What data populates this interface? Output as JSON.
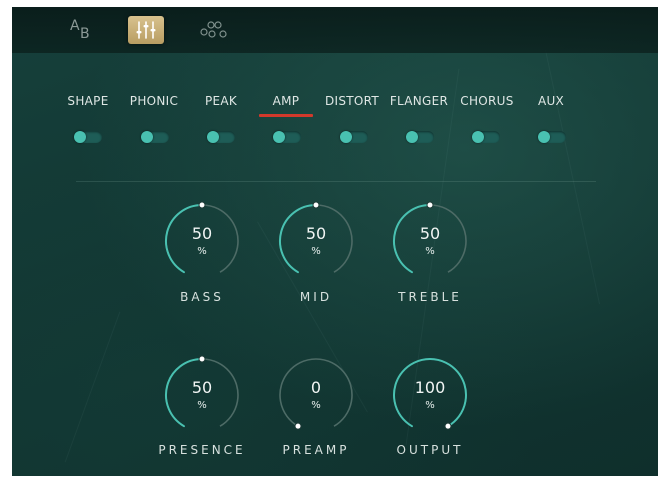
{
  "toolbar": {
    "ab_a": "A",
    "ab_b": "B",
    "icons": [
      "ab-compare-icon",
      "sliders-icon",
      "nodes-icon"
    ],
    "active": "sliders-icon",
    "active_color": "#c9b27a"
  },
  "tabs": [
    {
      "label": "SHAPE"
    },
    {
      "label": "PHONIC"
    },
    {
      "label": "PEAK"
    },
    {
      "label": "AMP",
      "active": true
    },
    {
      "label": "DISTORT"
    },
    {
      "label": "FLANGER"
    },
    {
      "label": "CHORUS"
    },
    {
      "label": "AUX"
    }
  ],
  "toggles": [
    {
      "name": "SHAPE",
      "on": false
    },
    {
      "name": "PHONIC",
      "on": false
    },
    {
      "name": "PEAK",
      "on": false
    },
    {
      "name": "AMP",
      "on": false
    },
    {
      "name": "DISTORT",
      "on": false
    },
    {
      "name": "FLANGER",
      "on": false
    },
    {
      "name": "CHORUS",
      "on": false
    },
    {
      "name": "AUX",
      "on": false
    }
  ],
  "knobs": [
    {
      "label": "BASS",
      "value": "50",
      "unit": "%",
      "level": 50
    },
    {
      "label": "MID",
      "value": "50",
      "unit": "%",
      "level": 50
    },
    {
      "label": "TREBLE",
      "value": "50",
      "unit": "%",
      "level": 50
    },
    {
      "label": "PRESENCE",
      "value": "50",
      "unit": "%",
      "level": 50
    },
    {
      "label": "PREAMP",
      "value": "0",
      "unit": "%",
      "level": 0
    },
    {
      "label": "OUTPUT",
      "value": "100",
      "unit": "%",
      "level": 100
    }
  ],
  "colors": {
    "accent_teal": "#49c1b1",
    "active_tab_underline": "#d2392b",
    "background": "#143a36"
  }
}
